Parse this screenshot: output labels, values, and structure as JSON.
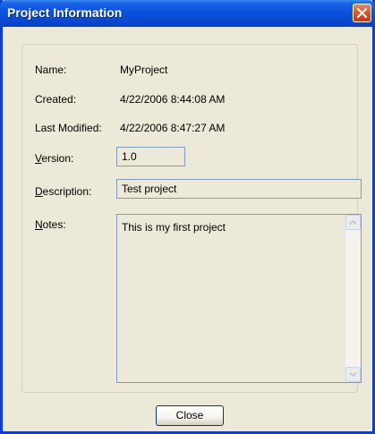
{
  "window": {
    "title": "Project Information",
    "close_icon": "close-icon"
  },
  "fields": {
    "name_label": "Name:",
    "name_value": "MyProject",
    "created_label": "Created:",
    "created_value": "4/22/2006 8:44:08 AM",
    "modified_label": "Last Modified:",
    "modified_value": "4/22/2006 8:47:27 AM",
    "version_label_mnemonic": "V",
    "version_label_rest": "ersion:",
    "version_value": "1.0",
    "description_label_mnemonic": "D",
    "description_label_rest": "escription:",
    "description_value": "Test project",
    "notes_label_mnemonic": "N",
    "notes_label_rest": "otes:",
    "notes_value": "This is my first project"
  },
  "buttons": {
    "close_label": "Close"
  },
  "colors": {
    "titlebar": "#0a52dc",
    "dialog_bg": "#ece9d8",
    "field_border": "#7f9db9"
  }
}
